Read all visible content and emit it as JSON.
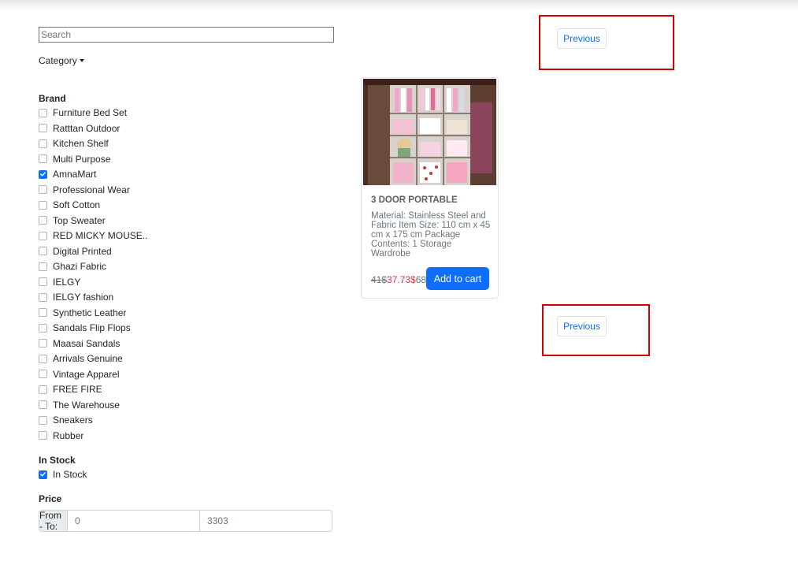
{
  "search": {
    "placeholder": "Search"
  },
  "category": {
    "label": "Category"
  },
  "brand": {
    "title": "Brand",
    "items": [
      {
        "label": "Furniture Bed Set",
        "checked": false
      },
      {
        "label": "Ratttan Outdoor",
        "checked": false
      },
      {
        "label": "Kitchen Shelf",
        "checked": false
      },
      {
        "label": "Multi Purpose",
        "checked": false
      },
      {
        "label": "AmnaMart",
        "checked": true
      },
      {
        "label": "Professional Wear",
        "checked": false
      },
      {
        "label": "Soft Cotton",
        "checked": false
      },
      {
        "label": "Top Sweater",
        "checked": false
      },
      {
        "label": "RED MICKY MOUSE..",
        "checked": false
      },
      {
        "label": "Digital Printed",
        "checked": false
      },
      {
        "label": "Ghazi Fabric",
        "checked": false
      },
      {
        "label": "IELGY",
        "checked": false
      },
      {
        "label": "IELGY fashion",
        "checked": false
      },
      {
        "label": "Synthetic Leather",
        "checked": false
      },
      {
        "label": "Sandals Flip Flops",
        "checked": false
      },
      {
        "label": "Maasai Sandals",
        "checked": false
      },
      {
        "label": "Arrivals Genuine",
        "checked": false
      },
      {
        "label": "Vintage Apparel",
        "checked": false
      },
      {
        "label": "FREE FIRE",
        "checked": false
      },
      {
        "label": "The Warehouse",
        "checked": false
      },
      {
        "label": "Sneakers",
        "checked": false
      },
      {
        "label": "Rubber",
        "checked": false
      }
    ]
  },
  "stock": {
    "title": "In Stock",
    "items": [
      {
        "label": "In Stock",
        "checked": true
      }
    ]
  },
  "price": {
    "title": "Price",
    "addon": "From - To:",
    "from_value": "0",
    "to_value": "3303"
  },
  "pagination": {
    "previous_label": "Previous"
  },
  "product": {
    "title": "3 DOOR PORTABLE",
    "description": "Material: Stainless Steel and Fabric Item Size: 110 cm x 45 cm x 175 cm Package Contents: 1 Storage Wardrobe",
    "old_price": "41$",
    "new_price": "37.73$",
    "discount": "68",
    "add_to_cart_label": "Add to cart"
  },
  "colors": {
    "accent": "#0d6efd",
    "sale_price": "#dc3545",
    "highlight_box": "#d40000"
  }
}
